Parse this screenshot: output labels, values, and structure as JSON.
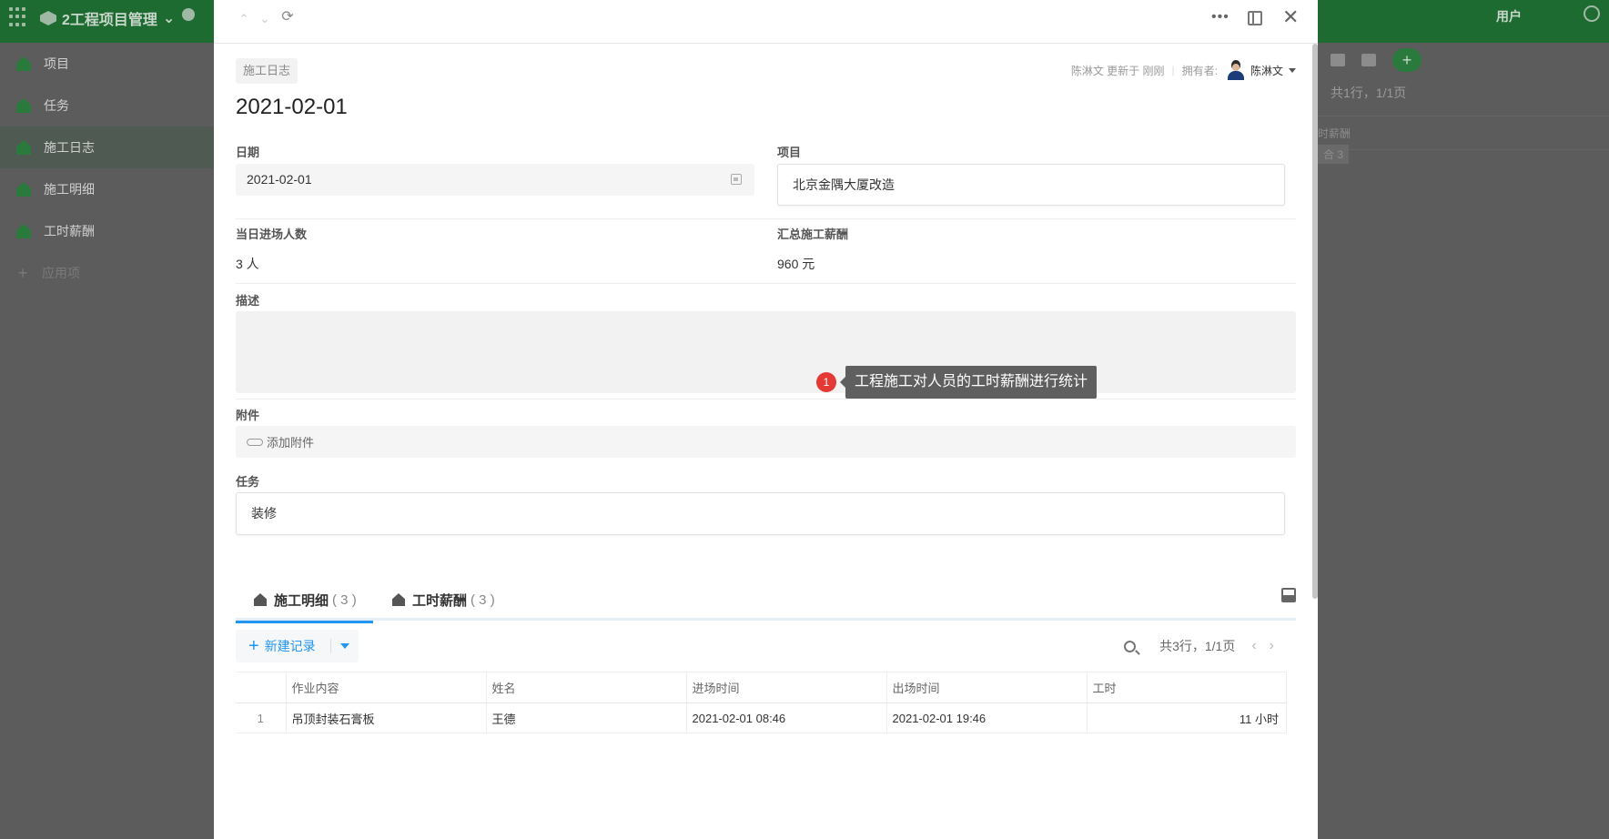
{
  "bg": {
    "app_title": "2工程项目管理",
    "user_label": "用户",
    "nav": [
      {
        "label": "项目"
      },
      {
        "label": "任务"
      },
      {
        "label": "施工日志"
      },
      {
        "label": "施工明细"
      },
      {
        "label": "工时薪酬"
      }
    ],
    "add_app_label": "应用项",
    "right_count": "共1行，1/1页",
    "right_col": "时薪酬",
    "right_badge": "合 3"
  },
  "record": {
    "tag": "施工日志",
    "updated_text": "陈淋文 更新于 刚刚",
    "owner_label": "拥有者:",
    "owner_name": "陈淋文",
    "title": "2021-02-01",
    "date_label": "日期",
    "date_value": "2021-02-01",
    "project_label": "项目",
    "project_value": "北京金隅大厦改造",
    "headcount_label": "当日进场人数",
    "headcount_value": "3 人",
    "salary_label": "汇总施工薪酬",
    "salary_value": "960 元",
    "desc_label": "描述",
    "attach_label": "附件",
    "attach_button": "添加附件",
    "task_label": "任务",
    "task_value": "装修"
  },
  "tooltip": {
    "badge": "1",
    "text": "工程施工对人员的工时薪酬进行统计"
  },
  "tabs": [
    {
      "label": "施工明细",
      "count": "( 3 )"
    },
    {
      "label": "工时薪酬",
      "count": "( 3 )"
    }
  ],
  "list": {
    "new_record": "新建记录",
    "summary": "共3行，1/1页",
    "columns": [
      "作业内容",
      "姓名",
      "进场时间",
      "出场时间",
      "工时"
    ],
    "rows": [
      {
        "idx": "1",
        "work": "吊顶封装石膏板",
        "name": "王德",
        "in": "2021-02-01 08:46",
        "out": "2021-02-01 19:46",
        "hours": "11 小时"
      }
    ]
  }
}
